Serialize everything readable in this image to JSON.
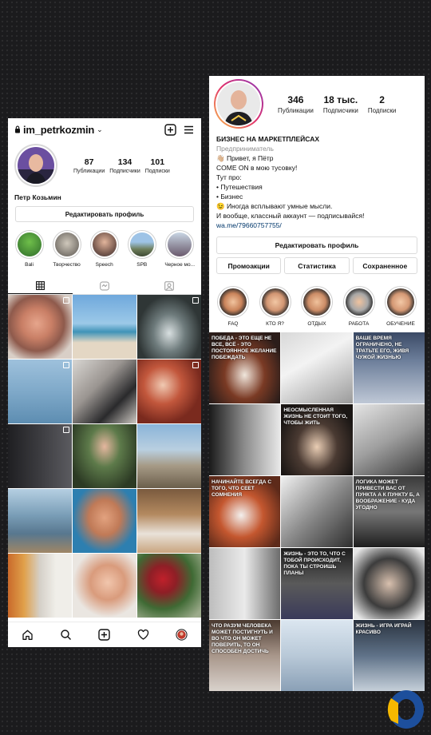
{
  "left": {
    "username": "im_petrkozmin",
    "stats": [
      {
        "num": "87",
        "label": "Публикации"
      },
      {
        "num": "134",
        "label": "Подписчики"
      },
      {
        "num": "101",
        "label": "Подписки"
      }
    ],
    "name": "Петр Козьмин",
    "edit_label": "Редактировать профиль",
    "highlights": [
      "Bali",
      "Творчество",
      "Speech",
      "SPB",
      "Черное мо..."
    ],
    "tabs": [
      "grid-icon",
      "reels-icon",
      "tagged-icon"
    ],
    "nav": [
      "home-icon",
      "search-icon",
      "add-icon",
      "heart-icon",
      "profile-icon"
    ]
  },
  "right": {
    "stats": [
      {
        "num": "346",
        "label": "Публикации"
      },
      {
        "num": "18 тыс.",
        "label": "Подписчики"
      },
      {
        "num": "2",
        "label": "Подписки"
      }
    ],
    "bio": {
      "title": "БИЗНЕС НА МАРКЕТПЛЕЙСАХ",
      "category": "Предприниматель",
      "lines": [
        "👋🏼 Привет, я Пётр",
        "COME ON в мою тусовку!",
        "Тут про:",
        "• Путешествия",
        "• Бизнес",
        "😉 Иногда всплывают умные мысли.",
        "И вообще, классный аккаунт — подписывайся!"
      ],
      "link": "wa.me/79660757755/"
    },
    "edit_label": "Редактировать профиль",
    "buttons": [
      "Промоакции",
      "Статистика",
      "Сохраненное"
    ],
    "highlights": [
      "FAQ",
      "КТО Я?",
      "ОТДЫХ",
      "РАБОТА",
      "ОБУЧЕНИЕ"
    ],
    "grid_captions": [
      "ПОБЕДА - ЭТО ЕЩЕ НЕ ВСЕ, ВСЁ - ЭТО ПОСТОЯННОЕ ЖЕЛАНИЕ ПОБЕЖДАТЬ",
      "",
      "ВАШЕ ВРЕМЯ ОГРАНИЧЕНО, НЕ ТРАТЬТЕ ЕГО, ЖИВЯ ЧУЖОЙ ЖИЗНЬЮ",
      "",
      "НЕОСМЫСЛЕННАЯ ЖИЗНЬ НЕ СТОИТ ТОГО, ЧТОБЫ ЖИТЬ",
      "",
      "НАЧИНАЙТЕ ВСЕГДА С ТОГО, ЧТО СЕЕТ СОМНЕНИЯ",
      "",
      "ЛОГИКА МОЖЕТ ПРИВЕСТИ ВАС ОТ ПУНКТА А К ПУНКТУ Б, А ВООБРАЖЕНИЕ - КУДА УГОДНО",
      "",
      "ЖИЗНЬ - ЭТО ТО, ЧТО С ТОБОЙ ПРОИСХОДИТ, ПОКА ТЫ СТРОИШЬ ПЛАНЫ",
      "",
      "ЧТО РАЗУМ ЧЕЛОВЕКА МОЖЕТ ПОСТИГНУТЬ И ВО ЧТО ОН МОЖЕТ ПОВЕРИТЬ, ТО ОН СПОСОБЕН ДОСТИЧЬ",
      "",
      "ЖИЗНЬ - ИГРА ИГРАЙ КРАСИВО"
    ]
  },
  "colors": {
    "logo_yellow": "#f5b800",
    "logo_blue": "#1d4f9c",
    "link": "#00376b"
  }
}
